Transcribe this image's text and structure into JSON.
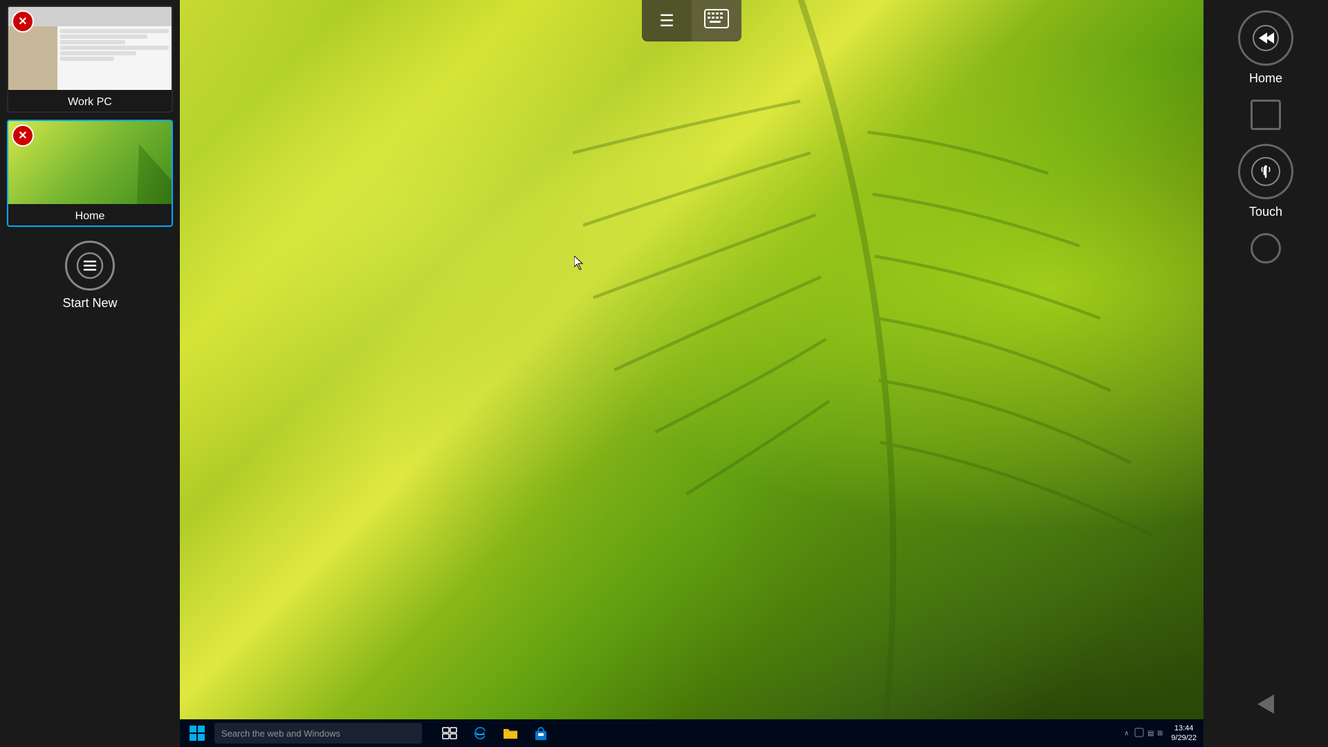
{
  "sidebar": {
    "sessions": [
      {
        "id": "work-pc",
        "label": "Work PC",
        "active": false,
        "type": "browser"
      },
      {
        "id": "home",
        "label": "Home",
        "active": true,
        "type": "leaf"
      }
    ],
    "start_new_label": "Start New"
  },
  "toolbar": {
    "menu_icon": "☰",
    "keyboard_icon": "⌨"
  },
  "taskbar": {
    "start_label": "⊞",
    "search_placeholder": "Search the web and Windows",
    "apps": [
      "task-view",
      "edge",
      "explorer",
      "store"
    ],
    "time": "13:44",
    "date": "9/29/22"
  },
  "right_nav": {
    "home_label": "Home",
    "touch_label": "Touch"
  },
  "desktop": {
    "bg_description": "green leaf macro photo"
  }
}
